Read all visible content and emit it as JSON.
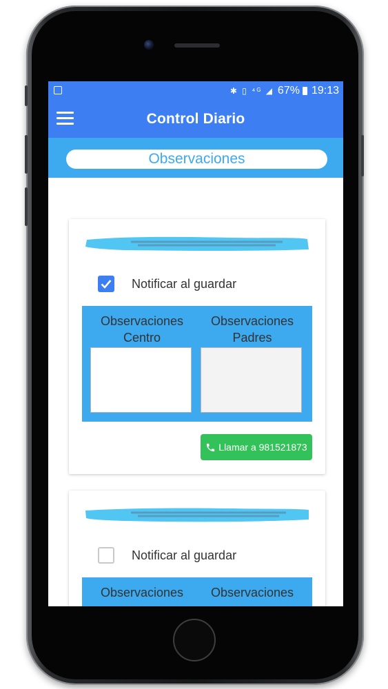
{
  "statusbar": {
    "battery_percent": "67%",
    "time": "19:13",
    "icons": [
      "image-icon",
      "bluetooth-icon",
      "vibrate-icon",
      "network-4g-icon",
      "signal-icon",
      "battery-icon"
    ]
  },
  "appbar": {
    "menu_icon": "hamburger-menu-icon",
    "title": "Control Diario"
  },
  "section": {
    "title": "Observaciones"
  },
  "cards": [
    {
      "notify_label": "Notificar al guardar",
      "notify_checked": true,
      "obs_centro_line1": "Observaciones",
      "obs_centro_line2": "Centro",
      "obs_padres_line1": "Observaciones",
      "obs_padres_line2": "Padres",
      "obs_centro_value": "",
      "obs_padres_value": "",
      "call_label": "Llamar a 981521873",
      "call_icon": "phone-icon"
    },
    {
      "notify_label": "Notificar al guardar",
      "notify_checked": false,
      "obs_centro_line1": "Observaciones",
      "obs_padres_line1": "Observaciones"
    }
  ],
  "colors": {
    "primary": "#3d7ff2",
    "accent": "#3da9ef",
    "call_button": "#33c25a"
  }
}
